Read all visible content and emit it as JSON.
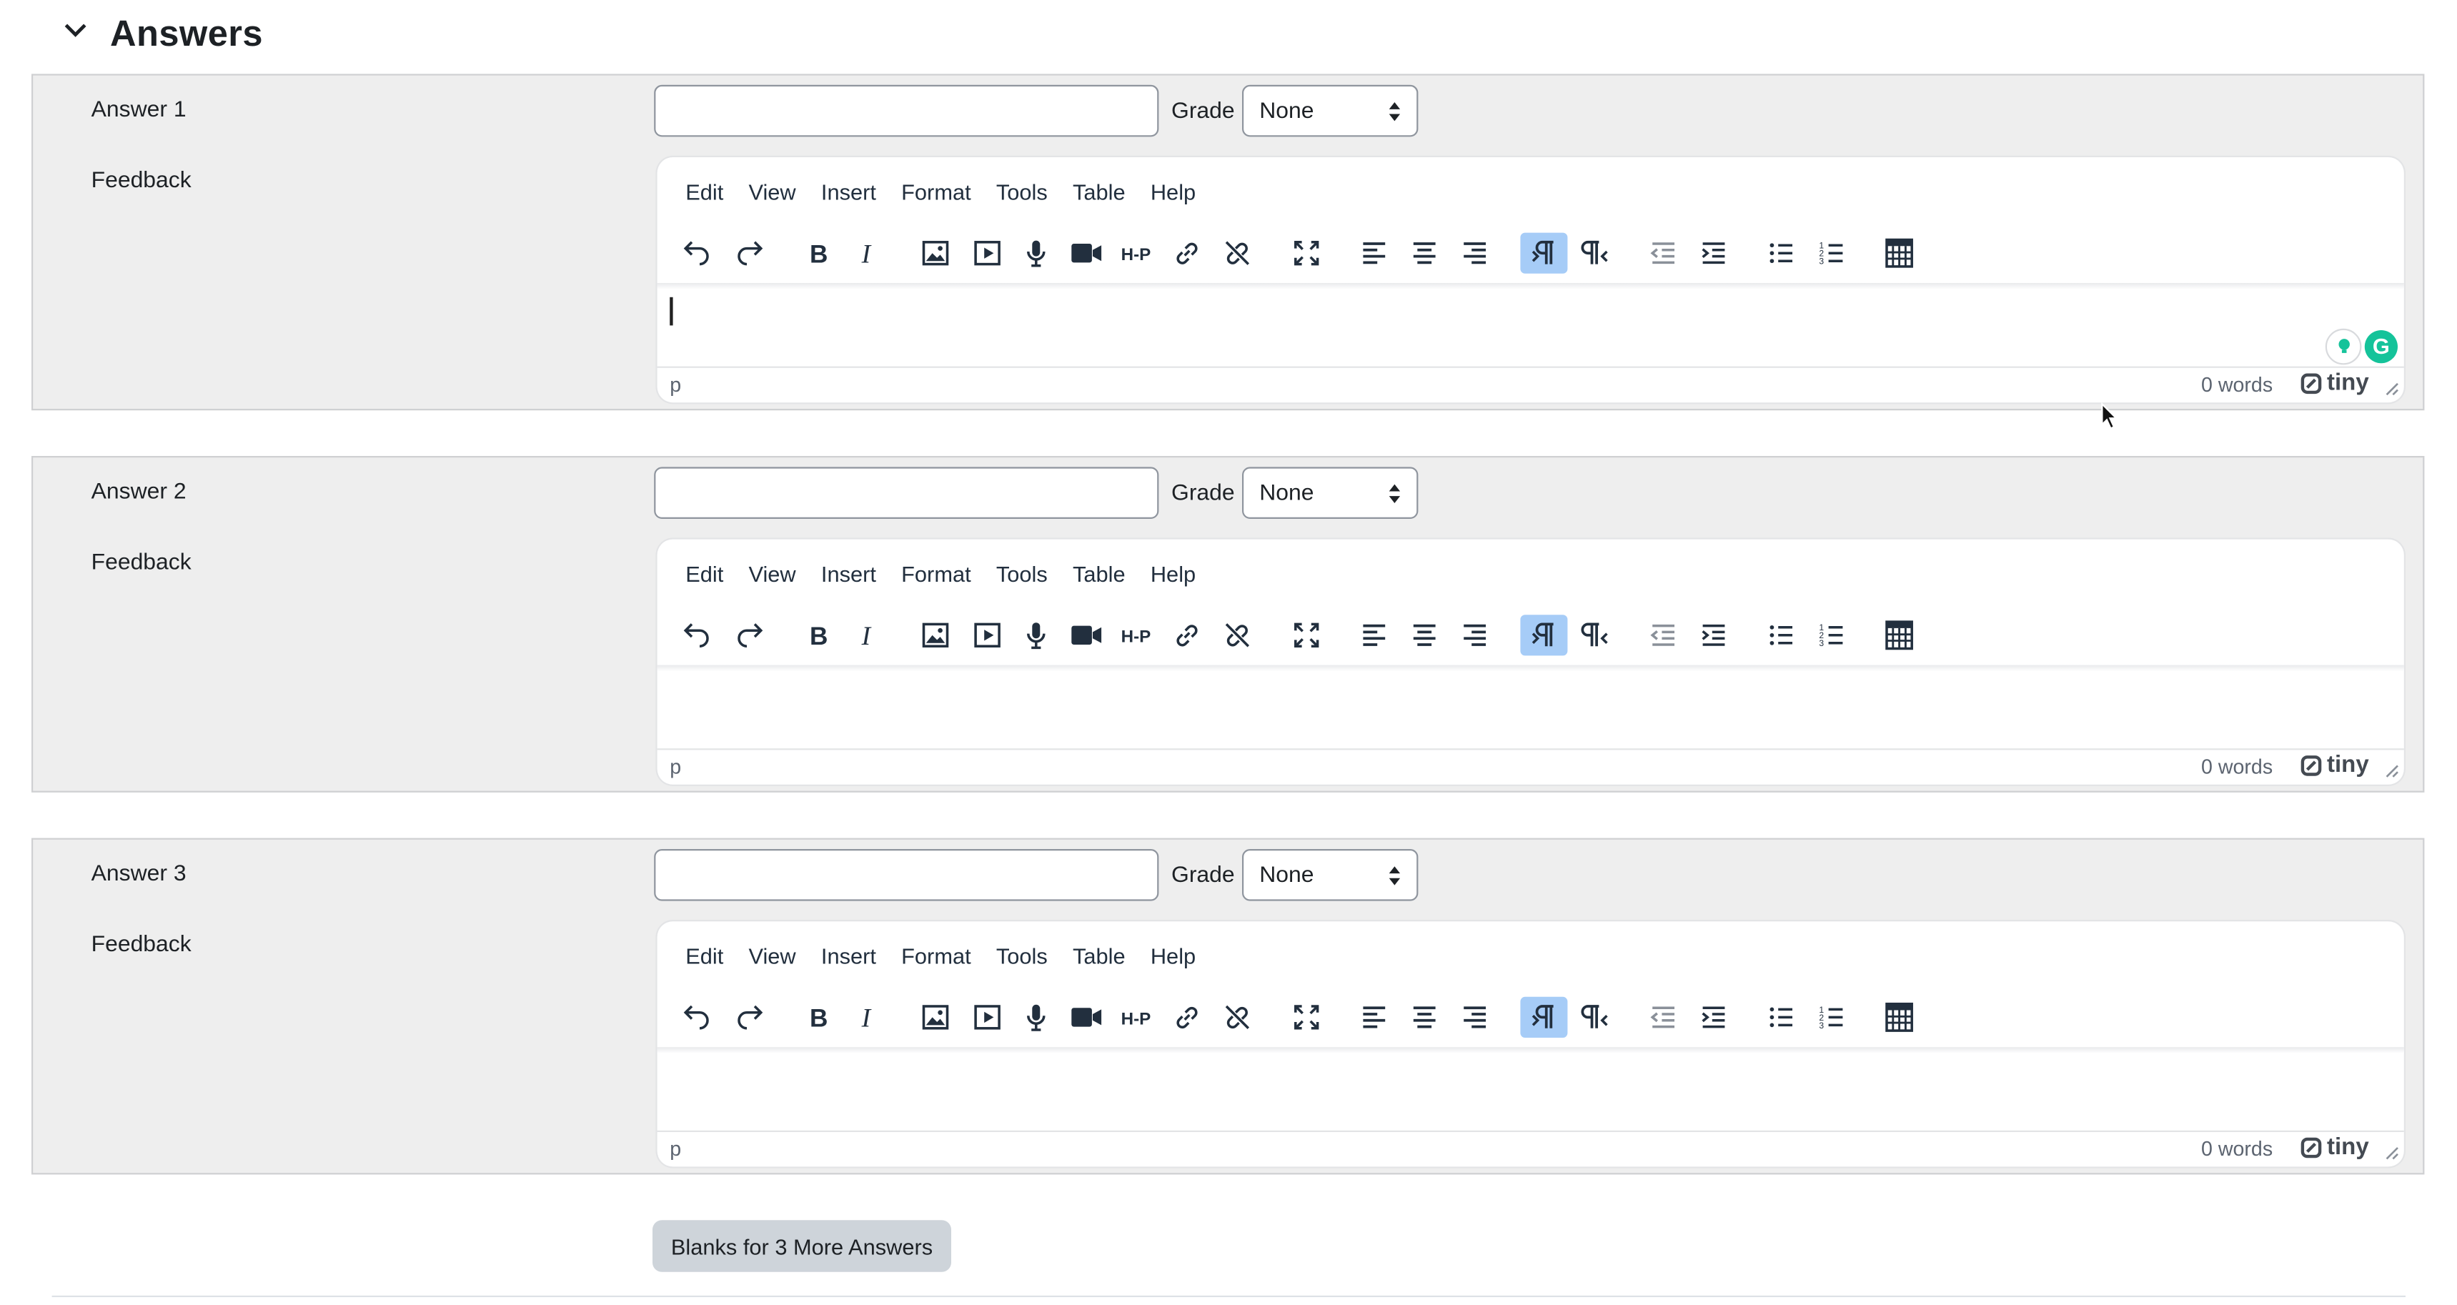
{
  "section": {
    "title": "Answers"
  },
  "answers": [
    {
      "label": "Answer 1",
      "value": "",
      "grade_label": "Grade",
      "grade_value": "None",
      "feedback_label": "Feedback"
    },
    {
      "label": "Answer 2",
      "value": "",
      "grade_label": "Grade",
      "grade_value": "None",
      "feedback_label": "Feedback"
    },
    {
      "label": "Answer 3",
      "value": "",
      "grade_label": "Grade",
      "grade_value": "None",
      "feedback_label": "Feedback"
    }
  ],
  "editor": {
    "menu": [
      "Edit",
      "View",
      "Insert",
      "Format",
      "Tools",
      "Table",
      "Help"
    ],
    "toolbar_icons": [
      "undo-icon",
      "redo-icon",
      "bold-icon",
      "italic-icon",
      "image-icon",
      "media-icon",
      "microphone-icon",
      "video-camera-icon",
      "h5p-icon",
      "link-icon",
      "unlink-icon",
      "fullscreen-icon",
      "align-left-icon",
      "align-center-icon",
      "align-right-icon",
      "ltr-icon",
      "rtl-icon",
      "outdent-icon",
      "indent-icon",
      "bullet-list-icon",
      "numbered-list-icon",
      "calculator-icon"
    ],
    "path": "p",
    "word_count": "0 words",
    "brand": "tiny",
    "active_button": "ltr-icon"
  },
  "more_button": {
    "label": "Blanks for 3 More Answers"
  },
  "colors": {
    "block_bg": "#eeeeee",
    "active_tool": "#a6ccf7",
    "button_bg": "#ced4da"
  }
}
